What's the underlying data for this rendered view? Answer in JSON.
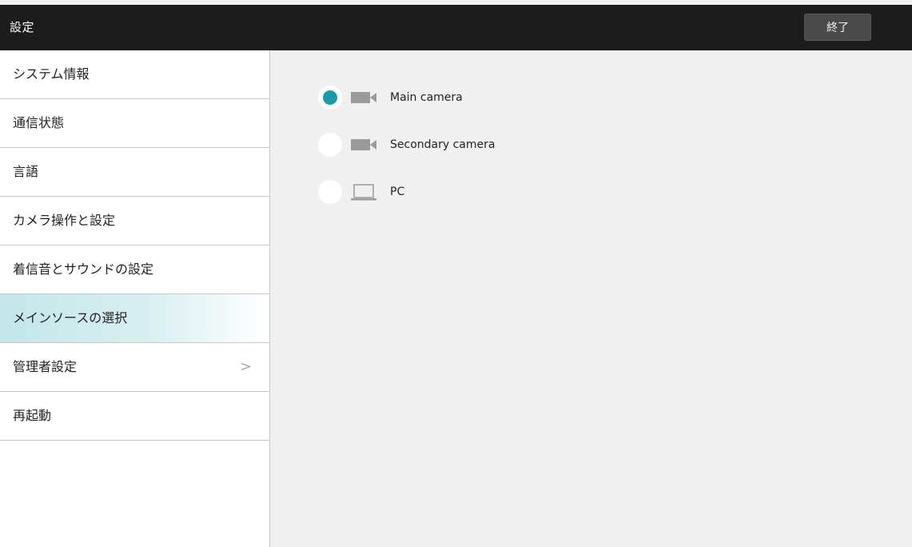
{
  "header": {
    "title": "設定",
    "exit_label": "終了"
  },
  "sidebar": {
    "items": [
      {
        "label": "システム情報",
        "selected": false,
        "has_chevron": false
      },
      {
        "label": "通信状態",
        "selected": false,
        "has_chevron": false
      },
      {
        "label": "言語",
        "selected": false,
        "has_chevron": false
      },
      {
        "label": "カメラ操作と設定",
        "selected": false,
        "has_chevron": false
      },
      {
        "label": "着信音とサウンドの設定",
        "selected": false,
        "has_chevron": false
      },
      {
        "label": "メインソースの選択",
        "selected": true,
        "has_chevron": false
      },
      {
        "label": "管理者設定",
        "selected": false,
        "has_chevron": true
      },
      {
        "label": "再起動",
        "selected": false,
        "has_chevron": false
      }
    ],
    "chevron_glyph": ">"
  },
  "main_source": {
    "options": [
      {
        "label": "Main camera",
        "icon": "video-camera-icon",
        "checked": true
      },
      {
        "label": "Secondary camera",
        "icon": "video-camera-icon",
        "checked": false
      },
      {
        "label": "PC",
        "icon": "laptop-icon",
        "checked": false
      }
    ]
  },
  "colors": {
    "topbar": "#1c1c1c",
    "accent": "#1b9aaa",
    "selected_row": "#c3e6e9",
    "content_bg": "#f0f0f0"
  }
}
